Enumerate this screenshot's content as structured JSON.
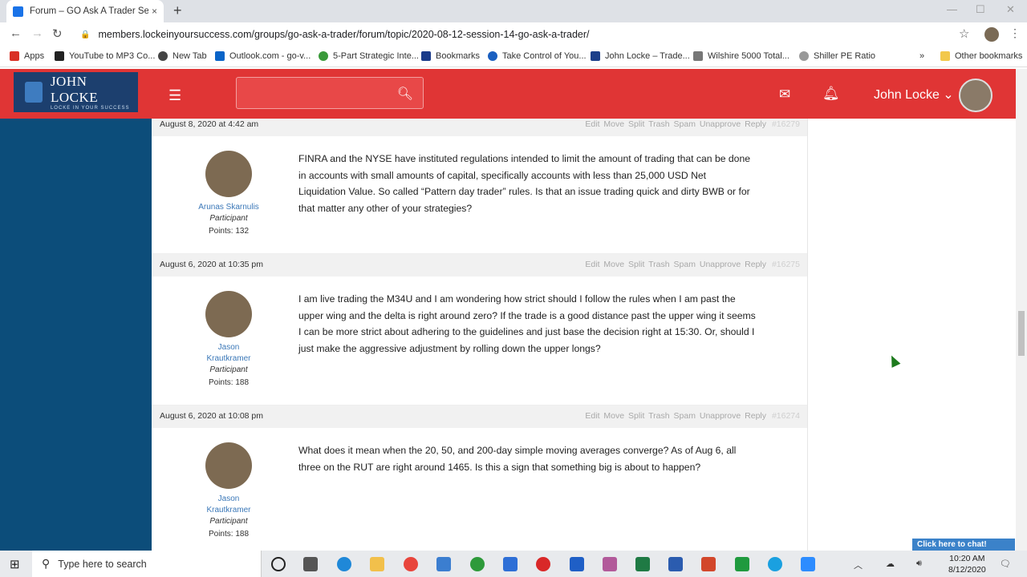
{
  "browser": {
    "tab_title": "Forum – GO Ask A Trader Session",
    "tab_close": "×",
    "new_tab": "+",
    "url": "members.lockeinyoursuccess.com/groups/go-ask-a-trader/forum/topic/2020-08-12-session-14-go-ask-a-trader/",
    "bookmarks": [
      {
        "label": "Apps",
        "color": "#d93025"
      },
      {
        "label": "YouTube to MP3 Co...",
        "color": "#222222"
      },
      {
        "label": "New Tab",
        "color": "#444444"
      },
      {
        "label": "Outlook.com - go-v...",
        "color": "#0a64c8"
      },
      {
        "label": "5-Part Strategic Inte...",
        "color": "#3a9a3a"
      },
      {
        "label": "Bookmarks",
        "color": "#1a3b8a"
      },
      {
        "label": "Take Control of You...",
        "color": "#1a5fc0"
      },
      {
        "label": "John Locke – Trade...",
        "color": "#1c3f8a"
      },
      {
        "label": "Wilshire 5000 Total...",
        "color": "#777777"
      },
      {
        "label": "Shiller PE Ratio",
        "color": "#999999"
      }
    ],
    "more_bookmarks": "»",
    "other_bookmarks": "Other bookmarks"
  },
  "site": {
    "logo_name": "JOHN LOCKE",
    "logo_tagline": "LOCKE IN YOUR SUCCESS",
    "user_name": "John Locke",
    "user_chevron": "⌄",
    "accent": "#e03535",
    "sidebar_color": "#0c4d7a"
  },
  "actions_label": "Edit  Move  Split  Trash  Spam  Unapprove  Reply",
  "replies": [
    {
      "date": "August 8, 2020 at 4:42 am",
      "id": "#16279",
      "author": "Arunas Skarnulis",
      "role": "Participant",
      "points": "Points: 132",
      "text": "FINRA and the NYSE have instituted regulations intended to limit the amount of trading that can be done in accounts with small amounts of capital, specifically accounts with less than 25,000 USD Net Liquidation Value. So called “Pattern day trader” rules. Is that an issue trading quick and dirty BWB or for that matter any other of your strategies?"
    },
    {
      "date": "August 6, 2020 at 10:35 pm",
      "id": "#16275",
      "author": "Jason Krautkramer",
      "role": "Participant",
      "points": "Points: 188",
      "text": "I am live trading the M34U and I am wondering how strict should I follow the rules when I am past the upper wing and the delta is right around zero? If the trade is a good distance past the upper wing it seems I can be more strict about adhering to the guidelines and just base the decision right at 15:30. Or, should I just make the aggressive adjustment by rolling down the upper longs?"
    },
    {
      "date": "August 6, 2020 at 10:08 pm",
      "id": "#16274",
      "author": "Jason Krautkramer",
      "role": "Participant",
      "points": "Points: 188",
      "text": "What does it mean when the 20, 50, and 200-day simple moving averages converge? As of Aug 6, all three on the RUT are right around 1465. Is this a sign that something big is about to happen?"
    }
  ],
  "chat_button": "Click here to chat!",
  "taskbar": {
    "search_placeholder": "Type here to search",
    "time": "10:20 AM",
    "date": "8/12/2020"
  }
}
